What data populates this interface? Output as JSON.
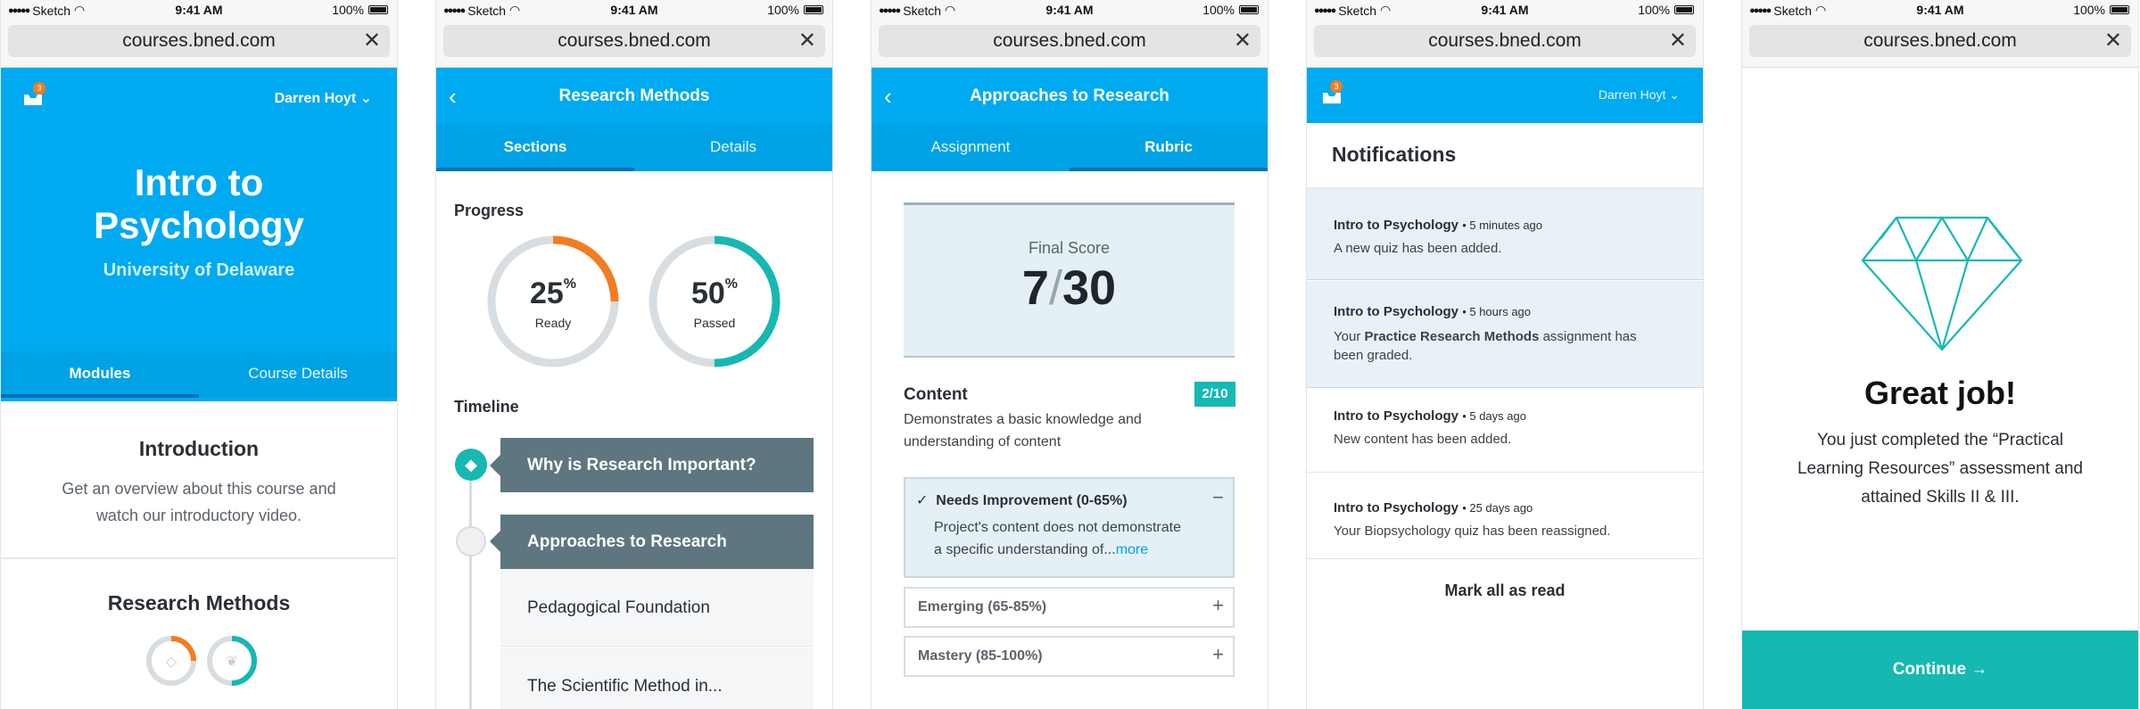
{
  "status": {
    "carrier": "Sketch",
    "time": "9:41 AM",
    "battery": "100%"
  },
  "url": "courses.bned.com",
  "screen1": {
    "badge": "3",
    "user": "Darren Hoyt",
    "title_line1": "Intro to",
    "title_line2": "Psychology",
    "subtitle": "University of Delaware",
    "tabs": [
      "Modules",
      "Course Details"
    ],
    "intro_title": "Introduction",
    "intro_line1": "Get an overview about this course and",
    "intro_line2": "watch our introductory video.",
    "section2_title": "Research Methods",
    "mini_progress": [
      0.25,
      0.5
    ]
  },
  "screen2": {
    "header": "Research Methods",
    "tabs": [
      "Sections",
      "Details"
    ],
    "progress_label": "Progress",
    "rings": [
      {
        "value": "25",
        "unit": "%",
        "label": "Ready",
        "fraction": 0.25,
        "color": "#f47c20"
      },
      {
        "value": "50",
        "unit": "%",
        "label": "Passed",
        "fraction": 0.5,
        "color": "#16b8b2"
      }
    ],
    "timeline_label": "Timeline",
    "items": [
      "Why is Research Important?",
      "Approaches to Research",
      "Pedagogical Foundation",
      "The Scientific Method in..."
    ]
  },
  "screen3": {
    "header": "Approaches to Research",
    "tabs": [
      "Assignment",
      "Rubric"
    ],
    "score_label": "Final Score",
    "score_num": "7",
    "score_sep": "/",
    "score_den": "30",
    "content_title": "Content",
    "content_badge": "2/10",
    "content_line1": "Demonstrates a basic knowledge and",
    "content_line2": "understanding of content",
    "check": "✓",
    "needs_title": "Needs Improvement (0-65%)",
    "minus": "−",
    "needs_line1": "Project's content does not demonstrate",
    "needs_line2": "a specific understanding of...",
    "more": "more",
    "rows": [
      "Emerging (65-85%)",
      "Mastery (85-100%)"
    ],
    "plus": "+"
  },
  "screen4": {
    "badge": "3",
    "user": "Darren Hoyt",
    "title": "Notifications",
    "items": [
      {
        "course": "Intro to Psychology",
        "time": "• 5 minutes ago",
        "line1": "A new quiz has been added.",
        "highlight": true
      },
      {
        "course": "Intro to Psychology",
        "time": "• 5 hours ago",
        "pre": "Your ",
        "bold": "Practice Research Methods",
        "post": " assignment has",
        "line2": "been graded.",
        "highlight": true
      },
      {
        "course": "Intro to Psychology",
        "time": "• 5 days ago",
        "line1": "New content has been added.",
        "highlight": false
      },
      {
        "course": "Intro to Psychology",
        "time": "• 25 days ago",
        "line1": "Your Biopsychology quiz has been reassigned.",
        "highlight": false
      }
    ],
    "mark_all": "Mark all as read"
  },
  "screen5": {
    "title": "Great job!",
    "line1": "You just completed the “Practical",
    "line2": "Learning Resources” assessment and",
    "line3": "attained Skills II & III.",
    "button": "Continue →"
  },
  "colors": {
    "blue": "#00aaf0",
    "orange": "#f47c20",
    "teal": "#16b8b2",
    "slate": "#5e7680"
  }
}
